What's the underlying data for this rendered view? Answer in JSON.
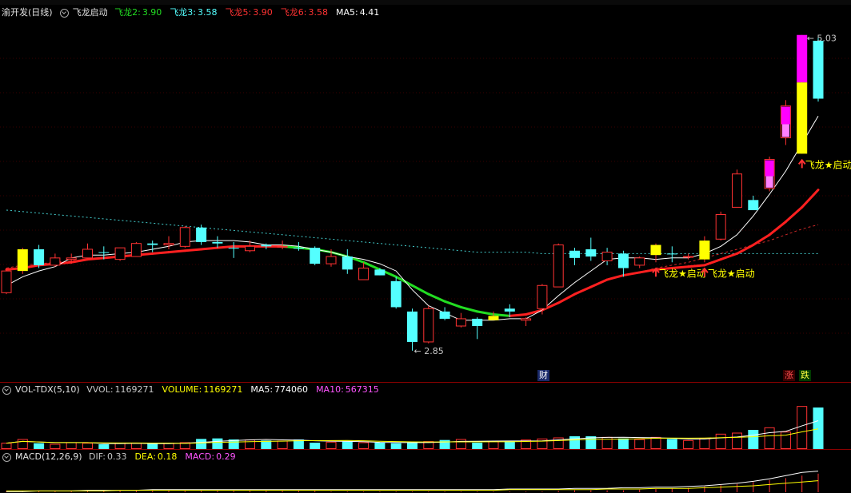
{
  "colors": {
    "up": "#ff3232",
    "down": "#54ffff",
    "ma_up": "#ff2020",
    "ma_down": "#22dd22",
    "yellow": "#ffff00",
    "magenta": "#ff00ff",
    "pink": "#ff80ff",
    "white": "#ffffff",
    "bg": "#000000"
  },
  "main": {
    "stock_name": "渝开发(日线)",
    "indicator_name": "飞龙启动",
    "params": [
      {
        "label": "飞龙2:",
        "value": "3.90",
        "color": "#22dd22"
      },
      {
        "label": "飞龙3:",
        "value": "3.58",
        "color": "#54ffff"
      },
      {
        "label": "飞龙5:",
        "value": "3.90",
        "color": "#ff3232"
      },
      {
        "label": "飞龙6:",
        "value": "3.58",
        "color": "#ff3232"
      },
      {
        "label": "MA5:",
        "value": "4.41",
        "color": "#ffffff"
      }
    ],
    "high_label": "5.03",
    "low_label": "2.85",
    "signal_label": "飞龙★启动",
    "badge_cai": "财",
    "badge_zhang": "涨",
    "badge_die": "跌"
  },
  "volume": {
    "name": "VOL-TDX(5,10)",
    "params": [
      {
        "label": "VVOL:",
        "value": "1169271",
        "color": "#c8c8c8"
      },
      {
        "label": "VOLUME:",
        "value": "1169271",
        "color": "#ffff00"
      },
      {
        "label": "MA5:",
        "value": "774060",
        "color": "#ffffff"
      },
      {
        "label": "MA10:",
        "value": "567315",
        "color": "#ff55ff"
      }
    ]
  },
  "macd": {
    "name": "MACD(12,26,9)",
    "params": [
      {
        "label": "DIF:",
        "value": "0.33",
        "color": "#c8c8c8"
      },
      {
        "label": "DEA:",
        "value": "0.18",
        "color": "#ffff00"
      },
      {
        "label": "MACD:",
        "value": "0.29",
        "color": "#ff55ff"
      }
    ]
  },
  "chart_data": {
    "type": "candlestick",
    "title": "渝开发(日线)",
    "ylim": [
      2.7,
      5.15
    ],
    "candles": [
      {
        "o": 3.25,
        "h": 3.42,
        "l": 3.24,
        "c": 3.4,
        "style": "up"
      },
      {
        "o": 3.4,
        "h": 3.56,
        "l": 3.38,
        "c": 3.55,
        "style": "yellow"
      },
      {
        "o": 3.55,
        "h": 3.58,
        "l": 3.42,
        "c": 3.44,
        "style": "down"
      },
      {
        "o": 3.44,
        "h": 3.52,
        "l": 3.43,
        "c": 3.49,
        "style": "up"
      },
      {
        "o": 3.48,
        "h": 3.52,
        "l": 3.45,
        "c": 3.49,
        "style": "up"
      },
      {
        "o": 3.49,
        "h": 3.59,
        "l": 3.49,
        "c": 3.55,
        "style": "up"
      },
      {
        "o": 3.53,
        "h": 3.57,
        "l": 3.48,
        "c": 3.53,
        "style": "down"
      },
      {
        "o": 3.48,
        "h": 3.56,
        "l": 3.47,
        "c": 3.56,
        "style": "up"
      },
      {
        "o": 3.5,
        "h": 3.6,
        "l": 3.5,
        "c": 3.59,
        "style": "up"
      },
      {
        "o": 3.59,
        "h": 3.61,
        "l": 3.53,
        "c": 3.58,
        "style": "down"
      },
      {
        "o": 3.58,
        "h": 3.64,
        "l": 3.55,
        "c": 3.59,
        "style": "up"
      },
      {
        "o": 3.57,
        "h": 3.71,
        "l": 3.56,
        "c": 3.7,
        "style": "up"
      },
      {
        "o": 3.7,
        "h": 3.72,
        "l": 3.58,
        "c": 3.6,
        "style": "down"
      },
      {
        "o": 3.6,
        "h": 3.64,
        "l": 3.56,
        "c": 3.59,
        "style": "down"
      },
      {
        "o": 3.56,
        "h": 3.6,
        "l": 3.49,
        "c": 3.56,
        "style": "down"
      },
      {
        "o": 3.54,
        "h": 3.61,
        "l": 3.53,
        "c": 3.57,
        "style": "up"
      },
      {
        "o": 3.57,
        "h": 3.59,
        "l": 3.55,
        "c": 3.58,
        "style": "down"
      },
      {
        "o": 3.57,
        "h": 3.61,
        "l": 3.55,
        "c": 3.57,
        "style": "up"
      },
      {
        "o": 3.56,
        "h": 3.6,
        "l": 3.54,
        "c": 3.56,
        "style": "down"
      },
      {
        "o": 3.56,
        "h": 3.57,
        "l": 3.44,
        "c": 3.45,
        "style": "down"
      },
      {
        "o": 3.45,
        "h": 3.55,
        "l": 3.43,
        "c": 3.5,
        "style": "up"
      },
      {
        "o": 3.5,
        "h": 3.55,
        "l": 3.38,
        "c": 3.41,
        "style": "down"
      },
      {
        "o": 3.34,
        "h": 3.46,
        "l": 3.34,
        "c": 3.42,
        "style": "up"
      },
      {
        "o": 3.41,
        "h": 3.42,
        "l": 3.37,
        "c": 3.37,
        "style": "down"
      },
      {
        "o": 3.33,
        "h": 3.36,
        "l": 3.14,
        "c": 3.15,
        "style": "down"
      },
      {
        "o": 3.12,
        "h": 3.14,
        "l": 2.85,
        "c": 2.91,
        "style": "down"
      },
      {
        "o": 2.91,
        "h": 3.16,
        "l": 2.9,
        "c": 3.14,
        "style": "up"
      },
      {
        "o": 3.12,
        "h": 3.15,
        "l": 3.06,
        "c": 3.07,
        "style": "down"
      },
      {
        "o": 3.02,
        "h": 3.11,
        "l": 3.01,
        "c": 3.07,
        "style": "up"
      },
      {
        "o": 3.07,
        "h": 3.08,
        "l": 2.93,
        "c": 3.02,
        "style": "down"
      },
      {
        "o": 3.06,
        "h": 3.12,
        "l": 3.06,
        "c": 3.09,
        "style": "yellow"
      },
      {
        "o": 3.14,
        "h": 3.17,
        "l": 3.08,
        "c": 3.12,
        "style": "down"
      },
      {
        "o": 3.06,
        "h": 3.08,
        "l": 3.02,
        "c": 3.07,
        "style": "up"
      },
      {
        "o": 3.14,
        "h": 3.31,
        "l": 3.1,
        "c": 3.3,
        "style": "up"
      },
      {
        "o": 3.29,
        "h": 3.59,
        "l": 3.29,
        "c": 3.58,
        "style": "up"
      },
      {
        "o": 3.49,
        "h": 3.56,
        "l": 3.44,
        "c": 3.54,
        "style": "down"
      },
      {
        "o": 3.55,
        "h": 3.63,
        "l": 3.47,
        "c": 3.5,
        "style": "down"
      },
      {
        "o": 3.53,
        "h": 3.56,
        "l": 3.44,
        "c": 3.47,
        "style": "up"
      },
      {
        "o": 3.52,
        "h": 3.54,
        "l": 3.36,
        "c": 3.42,
        "style": "down"
      },
      {
        "o": 3.44,
        "h": 3.5,
        "l": 3.42,
        "c": 3.49,
        "style": "up"
      },
      {
        "o": 3.58,
        "h": 3.59,
        "l": 3.46,
        "c": 3.51,
        "style": "yellow"
      },
      {
        "o": 3.52,
        "h": 3.57,
        "l": 3.46,
        "c": 3.52,
        "style": "down"
      },
      {
        "o": 3.5,
        "h": 3.52,
        "l": 3.48,
        "c": 3.5,
        "style": "up"
      },
      {
        "o": 3.48,
        "h": 3.64,
        "l": 3.46,
        "c": 3.61,
        "style": "yellow"
      },
      {
        "o": 3.62,
        "h": 3.81,
        "l": 3.61,
        "c": 3.79,
        "style": "up"
      },
      {
        "o": 3.84,
        "h": 4.1,
        "l": 3.84,
        "c": 4.07,
        "style": "up"
      },
      {
        "o": 3.89,
        "h": 3.92,
        "l": 3.82,
        "c": 3.82,
        "style": "down"
      },
      {
        "o": 3.97,
        "h": 4.19,
        "l": 3.95,
        "c": 4.17,
        "style": "magpink"
      },
      {
        "o": 4.32,
        "h": 4.58,
        "l": 4.27,
        "c": 4.54,
        "style": "magpink"
      },
      {
        "o": 4.21,
        "h": 5.03,
        "l": 4.21,
        "c": 5.03,
        "style": "yelmag"
      },
      {
        "o": 4.99,
        "h": 5.01,
        "l": 4.57,
        "c": 4.59,
        "style": "down"
      }
    ],
    "ma5": [
      3.3,
      3.36,
      3.4,
      3.43,
      3.49,
      3.51,
      3.51,
      3.52,
      3.53,
      3.55,
      3.57,
      3.6,
      3.61,
      3.61,
      3.61,
      3.6,
      3.58,
      3.58,
      3.57,
      3.55,
      3.53,
      3.5,
      3.48,
      3.45,
      3.4,
      3.27,
      3.16,
      3.11,
      3.06,
      3.06,
      3.06,
      3.07,
      3.07,
      3.13,
      3.23,
      3.32,
      3.4,
      3.48,
      3.49,
      3.49,
      3.48,
      3.49,
      3.49,
      3.52,
      3.57,
      3.65,
      3.78,
      3.93,
      4.09,
      4.28,
      4.47
    ],
    "feilong_line": [
      3.41,
      3.42,
      3.44,
      3.45,
      3.46,
      3.48,
      3.49,
      3.5,
      3.51,
      3.52,
      3.53,
      3.54,
      3.55,
      3.56,
      3.57,
      3.57,
      3.57,
      3.57,
      3.56,
      3.55,
      3.53,
      3.5,
      3.46,
      3.41,
      3.36,
      3.3,
      3.24,
      3.19,
      3.15,
      3.12,
      3.1,
      3.09,
      3.1,
      3.13,
      3.18,
      3.24,
      3.29,
      3.34,
      3.37,
      3.39,
      3.41,
      3.42,
      3.43,
      3.44,
      3.48,
      3.52,
      3.58,
      3.65,
      3.74,
      3.84,
      3.96
    ],
    "dotted_ma": [
      3.82,
      3.81,
      3.8,
      3.79,
      3.78,
      3.77,
      3.76,
      3.75,
      3.74,
      3.73,
      3.72,
      3.71,
      3.7,
      3.69,
      3.68,
      3.67,
      3.66,
      3.65,
      3.64,
      3.63,
      3.62,
      3.61,
      3.6,
      3.59,
      3.58,
      3.57,
      3.56,
      3.55,
      3.54,
      3.53,
      3.53,
      3.53,
      3.53,
      3.52,
      3.52,
      3.52,
      3.52,
      3.52,
      3.52,
      3.52,
      3.52,
      3.52,
      3.52,
      3.52,
      3.52,
      3.52,
      3.52,
      3.52,
      3.52,
      3.52,
      3.52
    ],
    "red_dotted_ma": [
      3.42,
      3.44,
      3.45,
      3.46,
      3.47,
      3.48,
      3.49,
      3.5,
      3.51,
      3.52,
      3.53,
      3.54,
      3.55,
      3.56,
      3.57,
      3.57,
      3.57,
      3.57,
      3.56,
      3.55,
      3.53,
      3.5,
      3.46,
      3.41,
      3.36,
      3.3,
      3.24,
      3.19,
      3.15,
      3.12,
      3.1,
      3.09,
      3.1,
      3.13,
      3.18,
      3.24,
      3.29,
      3.34,
      3.37,
      3.39,
      3.42,
      3.44,
      3.46,
      3.49,
      3.52,
      3.55,
      3.58,
      3.61,
      3.65,
      3.69,
      3.72
    ],
    "signal_index": [
      40,
      43,
      49
    ],
    "volume": [
      55,
      90,
      55,
      45,
      60,
      55,
      45,
      55,
      55,
      50,
      55,
      60,
      95,
      100,
      90,
      85,
      80,
      75,
      90,
      60,
      65,
      70,
      60,
      60,
      55,
      60,
      70,
      85,
      90,
      60,
      70,
      75,
      85,
      95,
      105,
      120,
      120,
      110,
      100,
      90,
      110,
      95,
      80,
      100,
      140,
      150,
      180,
      200,
      160,
      400,
      390
    ],
    "vol_ylim": [
      0,
      450
    ],
    "macd_hist": [
      0.02,
      0.02,
      0.02,
      0.02,
      0.02,
      0.02,
      0.02,
      0.02,
      0.02,
      0.02,
      0.02,
      0.02,
      0.02,
      0.02,
      0.02,
      0.02,
      0.02,
      0.02,
      0.02,
      0.02,
      0.01,
      0.01,
      0.01,
      0.01,
      0.01,
      0.01,
      0.01,
      0.01,
      0.01,
      0.01,
      0.01,
      0.01,
      0.01,
      0.01,
      0.02,
      0.03,
      0.03,
      0.03,
      0.03,
      0.04,
      0.05,
      0.06,
      0.07,
      0.09,
      0.11,
      0.13,
      0.16,
      0.19,
      0.22,
      0.26,
      0.29
    ],
    "dif": [
      0.01,
      0.01,
      0.02,
      0.02,
      0.02,
      0.03,
      0.03,
      0.03,
      0.03,
      0.04,
      0.04,
      0.04,
      0.04,
      0.04,
      0.04,
      0.04,
      0.04,
      0.04,
      0.04,
      0.04,
      0.04,
      0.04,
      0.04,
      0.04,
      0.04,
      0.04,
      0.04,
      0.04,
      0.04,
      0.04,
      0.04,
      0.05,
      0.05,
      0.05,
      0.05,
      0.06,
      0.06,
      0.06,
      0.07,
      0.07,
      0.08,
      0.08,
      0.09,
      0.1,
      0.12,
      0.14,
      0.17,
      0.21,
      0.26,
      0.31,
      0.33
    ],
    "dea": [
      0.02,
      0.02,
      0.02,
      0.02,
      0.02,
      0.02,
      0.02,
      0.03,
      0.03,
      0.03,
      0.03,
      0.03,
      0.03,
      0.03,
      0.03,
      0.03,
      0.03,
      0.03,
      0.03,
      0.03,
      0.03,
      0.03,
      0.03,
      0.03,
      0.03,
      0.03,
      0.03,
      0.03,
      0.03,
      0.03,
      0.03,
      0.04,
      0.04,
      0.04,
      0.04,
      0.04,
      0.04,
      0.05,
      0.05,
      0.05,
      0.06,
      0.06,
      0.06,
      0.07,
      0.08,
      0.09,
      0.1,
      0.12,
      0.14,
      0.16,
      0.18
    ],
    "macd_ylim": [
      0,
      0.4
    ]
  }
}
